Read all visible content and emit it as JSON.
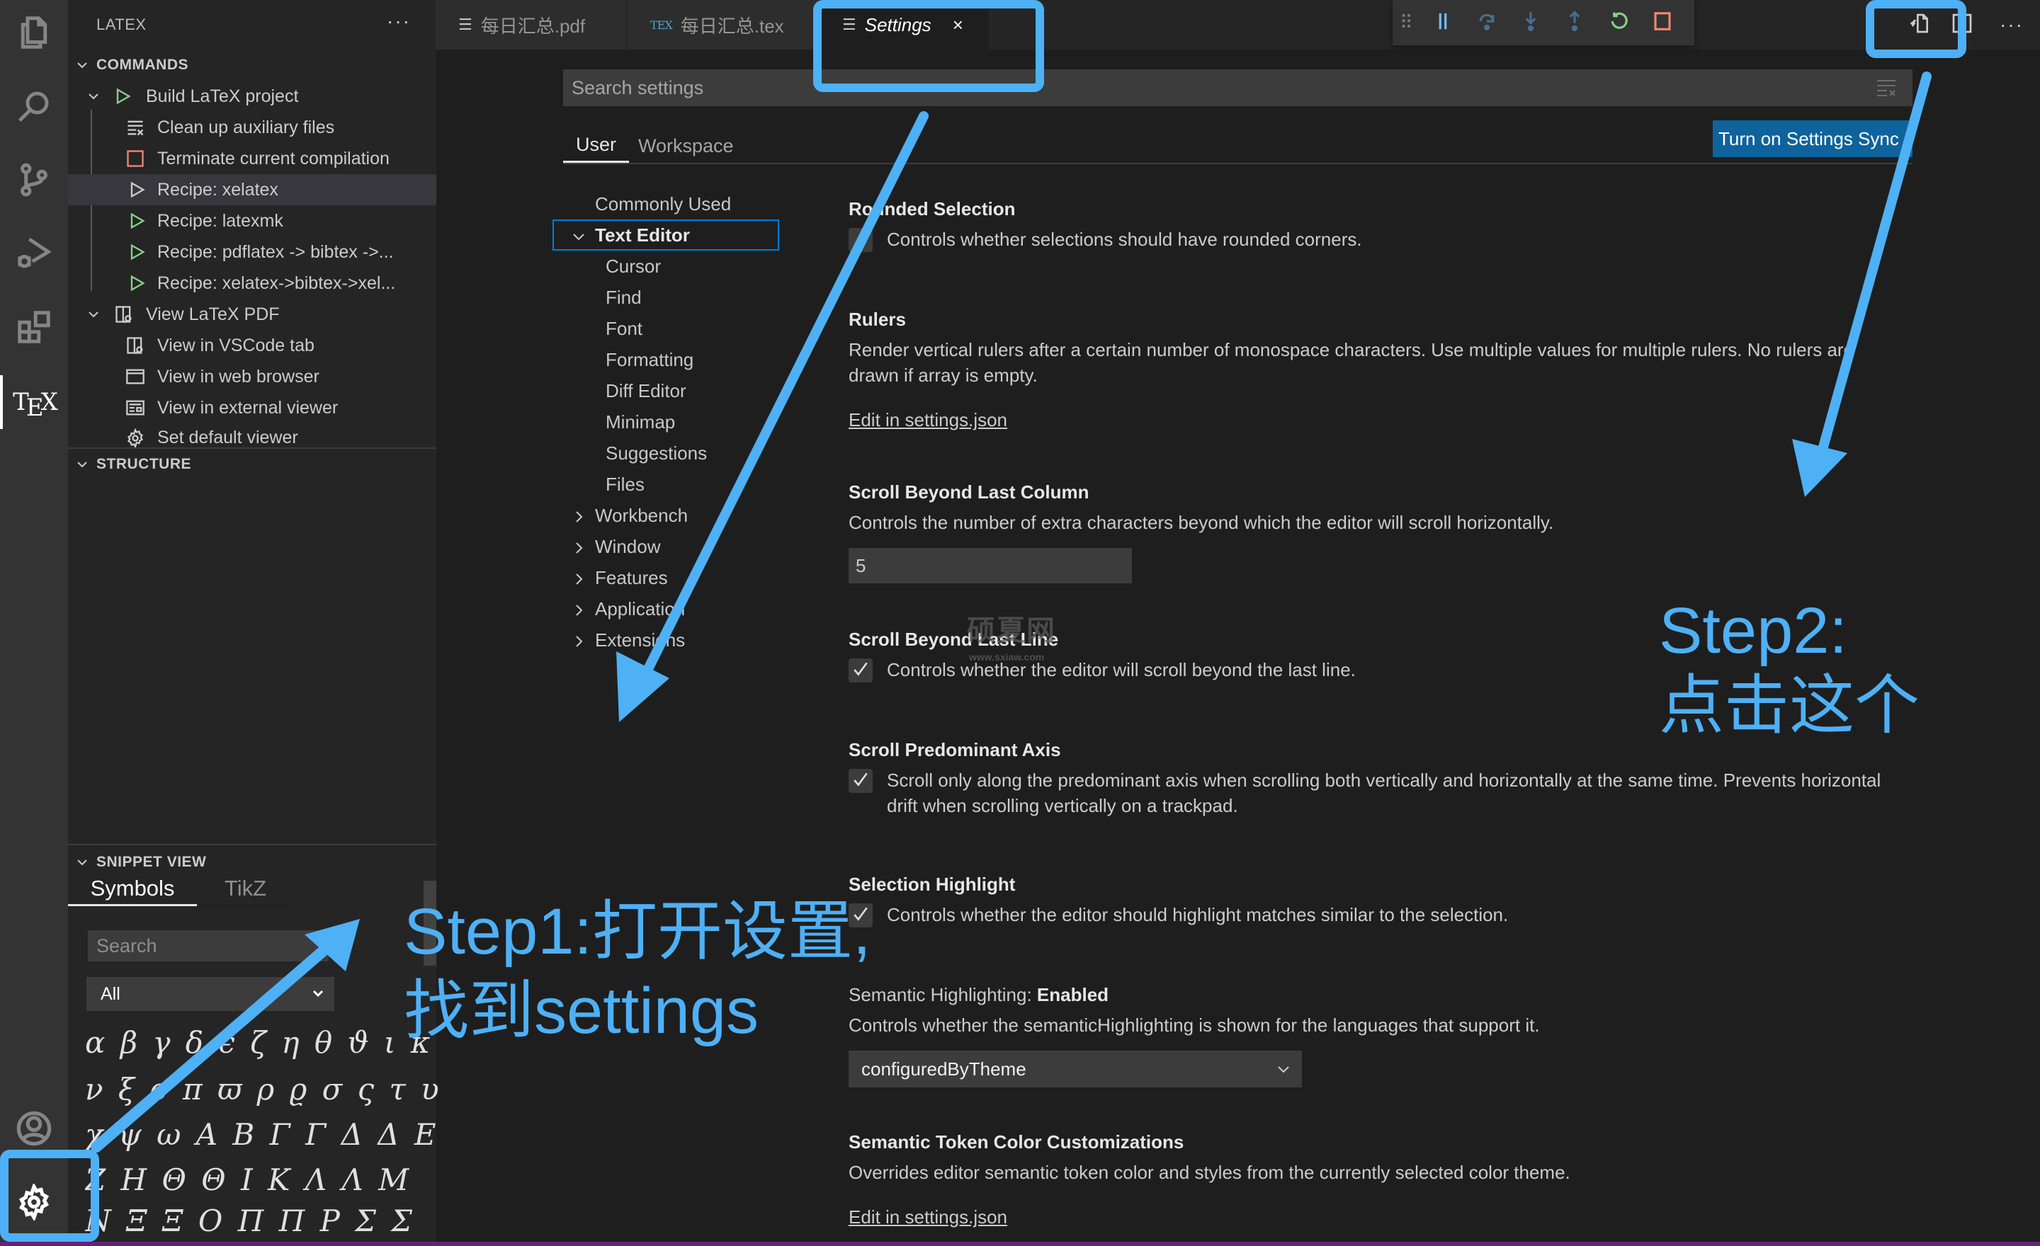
{
  "activity_bar": {
    "items": [
      {
        "name": "explorer",
        "icon": "files-icon"
      },
      {
        "name": "search",
        "icon": "search-icon"
      },
      {
        "name": "source-control",
        "icon": "source-control-icon"
      },
      {
        "name": "run-debug",
        "icon": "run-debug-icon"
      },
      {
        "name": "extensions",
        "icon": "extensions-icon"
      },
      {
        "name": "latex",
        "icon": "tex-icon",
        "label": "TEX",
        "active": true
      }
    ],
    "bottom": [
      {
        "name": "accounts",
        "icon": "account-icon"
      },
      {
        "name": "manage",
        "icon": "gear-icon"
      }
    ]
  },
  "sidebar": {
    "title": "LATEX",
    "more_label": "···",
    "commands": {
      "header": "COMMANDS",
      "items": [
        {
          "label": "Build LaTeX project",
          "icon": "play-icon",
          "level": 1,
          "expanded": true
        },
        {
          "label": "Clean up auxiliary files",
          "icon": "clear-all-icon",
          "level": 2
        },
        {
          "label": "Terminate current compilation",
          "icon": "stop-icon",
          "level": 2
        },
        {
          "label": "Recipe: xelatex",
          "icon": "play-icon",
          "level": 2,
          "selected": true
        },
        {
          "label": "Recipe: latexmk",
          "icon": "play-icon",
          "level": 2
        },
        {
          "label": "Recipe: pdflatex -> bibtex ->...",
          "icon": "play-icon",
          "level": 2
        },
        {
          "label": "Recipe: xelatex->bibtex->xel...",
          "icon": "play-icon",
          "level": 2
        },
        {
          "label": "View LaTeX PDF",
          "icon": "open-preview-icon",
          "level": 1,
          "expanded": true
        },
        {
          "label": "View in VSCode tab",
          "icon": "open-preview-icon",
          "level": 2
        },
        {
          "label": "View in web browser",
          "icon": "browser-icon",
          "level": 2
        },
        {
          "label": "View in external viewer",
          "icon": "window-icon",
          "level": 2
        },
        {
          "label": "Set default viewer",
          "icon": "gear-icon",
          "level": 2
        }
      ]
    },
    "structure": {
      "header": "STRUCTURE"
    },
    "snippet_view": {
      "header": "SNIPPET VIEW",
      "tabs": [
        {
          "label": "Symbols",
          "active": true
        },
        {
          "label": "TikZ",
          "active": false
        }
      ],
      "search_placeholder": "Search",
      "filter_value": "All",
      "symbol_rows": [
        "α β γ δ ϵ ζ η θ ϑ ι κ λ μ",
        "ν ξ ο π ϖ ρ ϱ σ ς τ υ ϕ φ",
        "χ ψ ω Α Β Γ Γ Δ Δ Ε",
        "Ζ Η Θ Θ Ι Κ Λ Λ Μ",
        "Ν Ξ Ξ Ο Π Π Ρ Σ Σ"
      ]
    }
  },
  "editor": {
    "tabs": [
      {
        "label": "每日汇总.pdf",
        "icon": "preview-icon",
        "active": false
      },
      {
        "label": "每日汇总.tex",
        "icon": "tex-file-icon",
        "active": false
      },
      {
        "label": "Settings",
        "icon": "settings-editor-icon",
        "active": true,
        "close_label": "×"
      }
    ],
    "debug_toolbar": [
      {
        "name": "drag-handle",
        "icon": "gripper-icon"
      },
      {
        "name": "pause",
        "icon": "pause-icon"
      },
      {
        "name": "step-over",
        "icon": "step-over-icon"
      },
      {
        "name": "step-into",
        "icon": "step-into-icon"
      },
      {
        "name": "step-out",
        "icon": "step-out-icon"
      },
      {
        "name": "restart",
        "icon": "restart-icon"
      },
      {
        "name": "stop",
        "icon": "stop-icon"
      }
    ],
    "actions": [
      {
        "name": "open-settings-json",
        "icon": "open-settings-json-icon"
      },
      {
        "name": "split-editor",
        "icon": "split-editor-icon"
      },
      {
        "name": "more-actions",
        "label": "···"
      }
    ]
  },
  "settings": {
    "search_placeholder": "Search settings",
    "scope_tabs": [
      {
        "label": "User",
        "active": true
      },
      {
        "label": "Workspace",
        "active": false
      }
    ],
    "sync_button": "Turn on Settings Sync",
    "toc": [
      {
        "label": "Commonly Used",
        "level": 0,
        "chevron": "none"
      },
      {
        "label": "Text Editor",
        "level": 0,
        "chevron": "down",
        "bold": true,
        "focused": true
      },
      {
        "label": "Cursor",
        "level": 1
      },
      {
        "label": "Find",
        "level": 1
      },
      {
        "label": "Font",
        "level": 1
      },
      {
        "label": "Formatting",
        "level": 1
      },
      {
        "label": "Diff Editor",
        "level": 1
      },
      {
        "label": "Minimap",
        "level": 1
      },
      {
        "label": "Suggestions",
        "level": 1
      },
      {
        "label": "Files",
        "level": 1
      },
      {
        "label": "Workbench",
        "level": 0,
        "chevron": "right"
      },
      {
        "label": "Window",
        "level": 0,
        "chevron": "right"
      },
      {
        "label": "Features",
        "level": 0,
        "chevron": "right"
      },
      {
        "label": "Application",
        "level": 0,
        "chevron": "right"
      },
      {
        "label": "Extensions",
        "level": 0,
        "chevron": "right"
      }
    ],
    "items": [
      {
        "title": "Rounded Selection",
        "type": "checkbox",
        "checked": false,
        "description": "Controls whether selections should have rounded corners."
      },
      {
        "title": "Rulers",
        "type": "link",
        "description": "Render vertical rulers after a certain number of monospace characters. Use multiple values for multiple rulers. No rulers are drawn if array is empty.",
        "link": "Edit in settings.json"
      },
      {
        "title": "Scroll Beyond Last Column",
        "type": "number",
        "description": "Controls the number of extra characters beyond which the editor will scroll horizontally.",
        "value": "5"
      },
      {
        "title": "Scroll Beyond Last Line",
        "type": "checkbox",
        "checked": true,
        "description": "Controls whether the editor will scroll beyond the last line."
      },
      {
        "title": "Scroll Predominant Axis",
        "type": "checkbox",
        "checked": true,
        "description": "Scroll only along the predominant axis when scrolling both vertically and horizontally at the same time. Prevents horizontal drift when scrolling vertically on a trackpad."
      },
      {
        "title": "Selection Highlight",
        "type": "checkbox",
        "checked": true,
        "description": "Controls whether the editor should highlight matches similar to the selection."
      },
      {
        "title_prefix": "Semantic Highlighting: ",
        "title": "Enabled",
        "type": "select",
        "description": "Controls whether the semanticHighlighting is shown for the languages that support it.",
        "value": "configuredByTheme"
      },
      {
        "title": "Semantic Token Color Customizations",
        "type": "link",
        "description": "Overrides editor semantic token color and styles from the currently selected color theme.",
        "link": "Edit in settings.json"
      }
    ]
  },
  "watermark": {
    "text": "硕夏网",
    "url": "www.sxiaw.com"
  },
  "annotations": {
    "color": "#4eb0f5",
    "step1_line1": "Step1:打开设置,",
    "step1_line2": "找到settings",
    "step2_line1": "Step2:",
    "step2_line2": "点击这个"
  },
  "colors": {
    "accent": "#0e639c",
    "focus_border": "#007fd4",
    "status_bar": "#68217a",
    "play_green": "#89d185",
    "stop_red": "#f48771"
  }
}
